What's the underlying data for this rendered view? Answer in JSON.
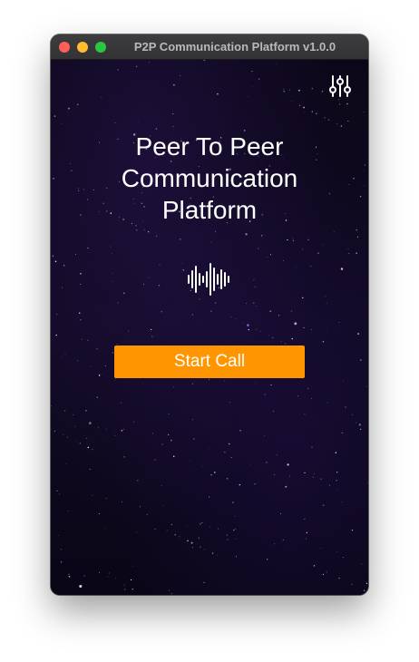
{
  "window": {
    "title": "P2P Communication Platform v1.0.0",
    "controls": [
      "close",
      "minimize",
      "zoom"
    ]
  },
  "toolbar": {
    "settings_icon": "sliders-icon"
  },
  "main": {
    "heading_lines": [
      "Peer To Peer",
      "Communication",
      "Platform"
    ],
    "audio_icon": "sound-wave-icon",
    "start_call_label": "Start Call"
  },
  "colors": {
    "accent": "#ff9500",
    "background": "#0d0820",
    "text": "#ffffff",
    "close": "#fe5f57",
    "minimize": "#febc2e",
    "zoom": "#28c840"
  }
}
